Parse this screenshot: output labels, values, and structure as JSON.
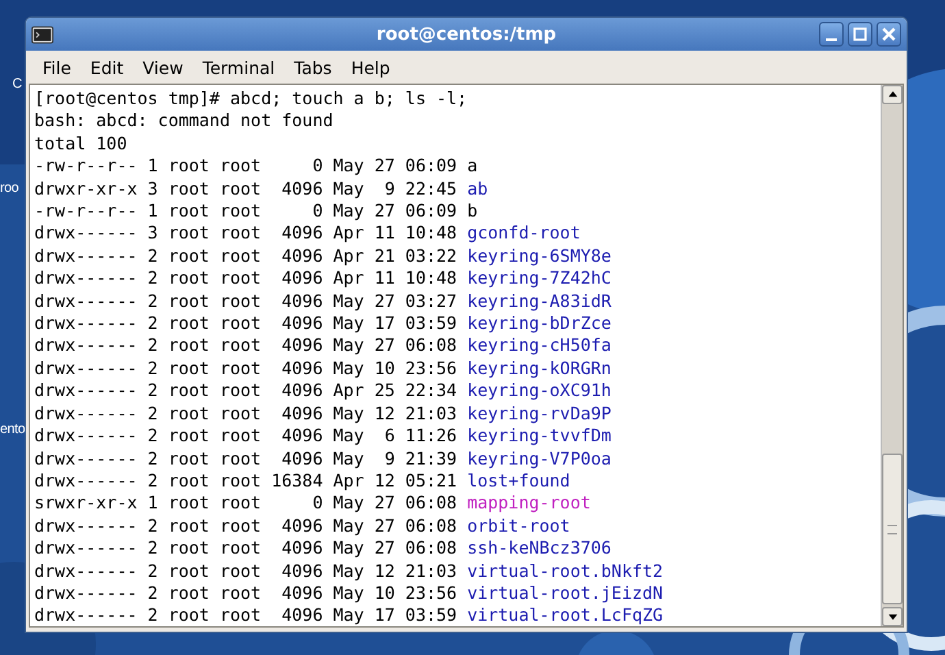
{
  "desktop_labels": [
    "C",
    "roo",
    "ento"
  ],
  "window": {
    "title": "root@centos:/tmp"
  },
  "menu": [
    "File",
    "Edit",
    "View",
    "Terminal",
    "Tabs",
    "Help"
  ],
  "terminal": {
    "lines": [
      "[root@centos tmp]# abcd; touch a b; ls -l;",
      "bash: abcd: command not found",
      "total 100"
    ],
    "entries": [
      {
        "details": "-rw-r--r-- 1 root root     0 May 27 06:09",
        "name": "a",
        "kind": "file"
      },
      {
        "details": "drwxr-xr-x 3 root root  4096 May  9 22:45",
        "name": "ab",
        "kind": "dir"
      },
      {
        "details": "-rw-r--r-- 1 root root     0 May 27 06:09",
        "name": "b",
        "kind": "file"
      },
      {
        "details": "drwx------ 3 root root  4096 Apr 11 10:48",
        "name": "gconfd-root",
        "kind": "dir"
      },
      {
        "details": "drwx------ 2 root root  4096 Apr 21 03:22",
        "name": "keyring-6SMY8e",
        "kind": "dir"
      },
      {
        "details": "drwx------ 2 root root  4096 Apr 11 10:48",
        "name": "keyring-7Z42hC",
        "kind": "dir"
      },
      {
        "details": "drwx------ 2 root root  4096 May 27 03:27",
        "name": "keyring-A83idR",
        "kind": "dir"
      },
      {
        "details": "drwx------ 2 root root  4096 May 17 03:59",
        "name": "keyring-bDrZce",
        "kind": "dir"
      },
      {
        "details": "drwx------ 2 root root  4096 May 27 06:08",
        "name": "keyring-cH50fa",
        "kind": "dir"
      },
      {
        "details": "drwx------ 2 root root  4096 May 10 23:56",
        "name": "keyring-kORGRn",
        "kind": "dir"
      },
      {
        "details": "drwx------ 2 root root  4096 Apr 25 22:34",
        "name": "keyring-oXC91h",
        "kind": "dir"
      },
      {
        "details": "drwx------ 2 root root  4096 May 12 21:03",
        "name": "keyring-rvDa9P",
        "kind": "dir"
      },
      {
        "details": "drwx------ 2 root root  4096 May  6 11:26",
        "name": "keyring-tvvfDm",
        "kind": "dir"
      },
      {
        "details": "drwx------ 2 root root  4096 May  9 21:39",
        "name": "keyring-V7P0oa",
        "kind": "dir"
      },
      {
        "details": "drwx------ 2 root root 16384 Apr 12 05:21",
        "name": "lost+found",
        "kind": "dir"
      },
      {
        "details": "srwxr-xr-x 1 root root     0 May 27 06:08",
        "name": "mapping-root",
        "kind": "socket"
      },
      {
        "details": "drwx------ 2 root root  4096 May 27 06:08",
        "name": "orbit-root",
        "kind": "dir"
      },
      {
        "details": "drwx------ 2 root root  4096 May 27 06:08",
        "name": "ssh-keNBcz3706",
        "kind": "dir"
      },
      {
        "details": "drwx------ 2 root root  4096 May 12 21:03",
        "name": "virtual-root.bNkft2",
        "kind": "dir"
      },
      {
        "details": "drwx------ 2 root root  4096 May 10 23:56",
        "name": "virtual-root.jEizdN",
        "kind": "dir"
      },
      {
        "details": "drwx------ 2 root root  4096 May 17 03:59",
        "name": "virtual-root.LcFqZG",
        "kind": "dir"
      }
    ]
  }
}
